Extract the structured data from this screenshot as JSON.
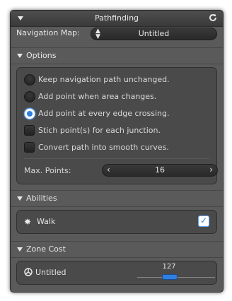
{
  "header": {
    "title": "Pathfinding",
    "refresh_icon": "refresh-icon"
  },
  "nav": {
    "label": "Navigation Map:",
    "value": "Untitled"
  },
  "options": {
    "title": "Options",
    "items": [
      {
        "label": "Keep navigation path unchanged.",
        "kind": "radio",
        "checked": false
      },
      {
        "label": "Add point when area changes.",
        "kind": "radio",
        "checked": false
      },
      {
        "label": "Add point at every edge crossing.",
        "kind": "radio",
        "checked": true
      },
      {
        "label": "Stich point(s) for each junction.",
        "kind": "checkbox",
        "checked": false
      },
      {
        "label": "Convert path into smooth curves.",
        "kind": "checkbox",
        "checked": false
      }
    ],
    "max_points": {
      "label": "Max. Points:",
      "value": "16"
    }
  },
  "abilities": {
    "title": "Abilities",
    "walk": {
      "label": "Walk",
      "checked": true,
      "icon": "walk-icon"
    }
  },
  "zone_cost": {
    "title": "Zone Cost",
    "zone": {
      "label": "Untitled",
      "value": "127",
      "fraction": 0.5,
      "icon": "zone-icon"
    }
  },
  "colors": {
    "accent": "#2f7fe0",
    "panel": "#5a5a5a",
    "header": "#3a3a3a"
  }
}
